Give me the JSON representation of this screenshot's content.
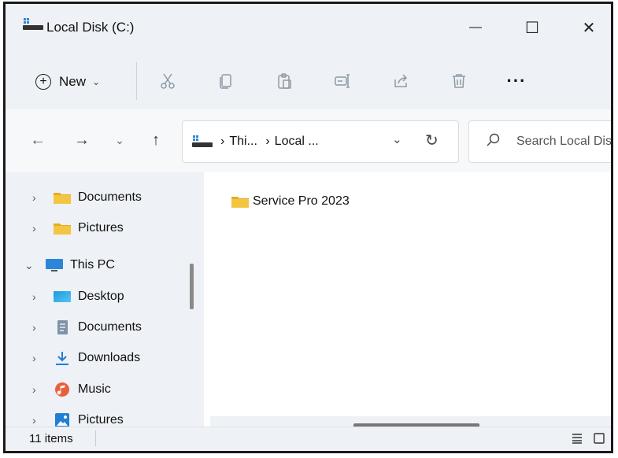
{
  "window": {
    "title": "Local Disk (C:)",
    "minimize_glyph": "—",
    "maximize_glyph": "☐",
    "close_glyph": "✕"
  },
  "toolbar": {
    "new_label": "New",
    "new_plus": "+",
    "new_caret": "⌄",
    "more_label": "···",
    "icons": [
      "cut-icon",
      "copy-icon",
      "paste-icon",
      "rename-icon",
      "share-icon",
      "delete-icon"
    ]
  },
  "nav": {
    "back": "←",
    "forward": "→",
    "recent": "⌄",
    "up": "↑"
  },
  "address": {
    "crumbs": [
      "›",
      "Thi...",
      "›",
      "Local ..."
    ],
    "chevron": "⌄",
    "refresh": "↻"
  },
  "search": {
    "placeholder": "Search Local Disk (C:)"
  },
  "sidebar": {
    "items": [
      {
        "label": "Documents",
        "icon": "folder-icon",
        "chevron": "›"
      },
      {
        "label": "Pictures",
        "icon": "folder-icon",
        "chevron": "›"
      },
      {
        "label": "This PC",
        "icon": "monitor-icon",
        "chevron": "⌄"
      },
      {
        "label": "Desktop",
        "icon": "desktop-icon",
        "chevron": "›"
      },
      {
        "label": "Documents",
        "icon": "document-icon",
        "chevron": "›"
      },
      {
        "label": "Downloads",
        "icon": "download-icon",
        "chevron": "›"
      },
      {
        "label": "Music",
        "icon": "music-icon",
        "chevron": "›"
      },
      {
        "label": "Pictures",
        "icon": "pictures-icon",
        "chevron": "›"
      }
    ]
  },
  "content": {
    "files": [
      {
        "name": "Service Pro 2023",
        "icon": "folder-icon"
      }
    ]
  },
  "status": {
    "item_count": "11 items"
  },
  "colors": {
    "folder": "#f4c542",
    "folder_tab": "#e6ac1f",
    "monitor": "#2b86d9",
    "download": "#1f7fd4",
    "music": "#e8603a"
  }
}
